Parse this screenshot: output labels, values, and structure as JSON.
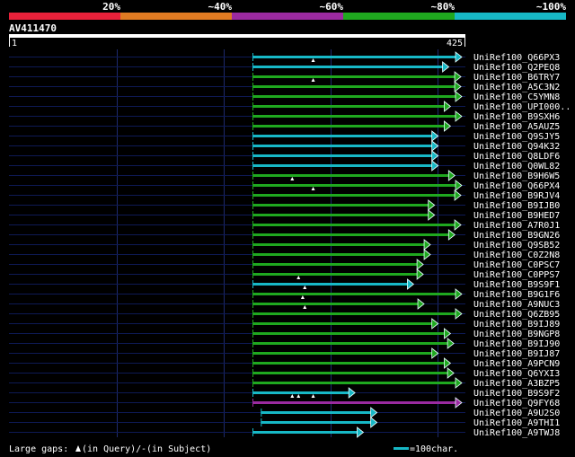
{
  "legend_bar": {
    "segments": [
      {
        "label": "20%",
        "color": "#e8213a"
      },
      {
        "label": "~40%",
        "color": "#e07b22"
      },
      {
        "label": "~60%",
        "color": "#9b2aa0"
      },
      {
        "label": "~80%",
        "color": "#1fa81f"
      },
      {
        "label": "~100%",
        "color": "#17b8c6"
      }
    ]
  },
  "query": {
    "id": "AV411470",
    "start": "1",
    "end": "425"
  },
  "hits": [
    {
      "name": "UniRef100_Q66PX3",
      "color": "cyan",
      "start": 0.0,
      "end": 1.0,
      "marks": []
    },
    {
      "name": "UniRef100_Q2PEQ8",
      "color": "cyan",
      "start": 0.0,
      "end": 0.938,
      "marks": [
        0.29
      ]
    },
    {
      "name": "UniRef100_B6TRY7",
      "color": "green",
      "start": 0.0,
      "end": 0.996,
      "marks": []
    },
    {
      "name": "UniRef100_A5C3N2",
      "color": "green",
      "start": 0.0,
      "end": 0.996,
      "marks": [
        0.29
      ]
    },
    {
      "name": "UniRef100_C5YMN8",
      "color": "green",
      "start": 0.0,
      "end": 1.0,
      "marks": []
    },
    {
      "name": "UniRef100_UPI000..",
      "color": "green",
      "start": 0.0,
      "end": 0.946,
      "marks": []
    },
    {
      "name": "UniRef100_B9SXH6",
      "color": "green",
      "start": 0.0,
      "end": 1.0,
      "marks": []
    },
    {
      "name": "UniRef100_A5AUZ5",
      "color": "green",
      "start": 0.0,
      "end": 0.946,
      "marks": []
    },
    {
      "name": "UniRef100_Q9SJY5",
      "color": "cyan",
      "start": 0.0,
      "end": 0.887,
      "marks": []
    },
    {
      "name": "UniRef100_Q94K32",
      "color": "cyan",
      "start": 0.0,
      "end": 0.887,
      "marks": []
    },
    {
      "name": "UniRef100_Q8LDF6",
      "color": "cyan",
      "start": 0.0,
      "end": 0.887,
      "marks": []
    },
    {
      "name": "UniRef100_Q0WL82",
      "color": "cyan",
      "start": 0.0,
      "end": 0.887,
      "marks": []
    },
    {
      "name": "UniRef100_B9H6W5",
      "color": "green",
      "start": 0.0,
      "end": 0.967,
      "marks": []
    },
    {
      "name": "UniRef100_Q66PX4",
      "color": "green",
      "start": 0.0,
      "end": 1.0,
      "marks": [
        0.19
      ]
    },
    {
      "name": "UniRef100_B9RJV4",
      "color": "green",
      "start": 0.0,
      "end": 0.996,
      "marks": [
        0.29
      ]
    },
    {
      "name": "UniRef100_B9IJB0",
      "color": "green",
      "start": 0.0,
      "end": 0.87,
      "marks": []
    },
    {
      "name": "UniRef100_B9HED7",
      "color": "green",
      "start": 0.0,
      "end": 0.87,
      "marks": []
    },
    {
      "name": "UniRef100_A7R0J1",
      "color": "green",
      "start": 0.0,
      "end": 0.996,
      "marks": []
    },
    {
      "name": "UniRef100_B9GN26",
      "color": "green",
      "start": 0.0,
      "end": 0.967,
      "marks": []
    },
    {
      "name": "UniRef100_Q9SB52",
      "color": "green",
      "start": 0.0,
      "end": 0.85,
      "marks": []
    },
    {
      "name": "UniRef100_C0Z2N8",
      "color": "green",
      "start": 0.0,
      "end": 0.85,
      "marks": []
    },
    {
      "name": "UniRef100_C0PSC7",
      "color": "green",
      "start": 0.0,
      "end": 0.816,
      "marks": []
    },
    {
      "name": "UniRef100_C0PPS7",
      "color": "green",
      "start": 0.0,
      "end": 0.816,
      "marks": []
    },
    {
      "name": "UniRef100_B9S9F1",
      "color": "cyan",
      "start": 0.0,
      "end": 0.77,
      "marks": [
        0.22
      ]
    },
    {
      "name": "UniRef100_B9G1F6",
      "color": "green",
      "start": 0.0,
      "end": 1.0,
      "marks": [
        0.25
      ]
    },
    {
      "name": "UniRef100_A9NUC3",
      "color": "green",
      "start": 0.0,
      "end": 0.82,
      "marks": [
        0.24
      ]
    },
    {
      "name": "UniRef100_Q6ZB95",
      "color": "green",
      "start": 0.0,
      "end": 1.0,
      "marks": [
        0.25
      ]
    },
    {
      "name": "UniRef100_B9IJ89",
      "color": "green",
      "start": 0.0,
      "end": 0.887,
      "marks": []
    },
    {
      "name": "UniRef100_B9NGP8",
      "color": "green",
      "start": 0.0,
      "end": 0.946,
      "marks": []
    },
    {
      "name": "UniRef100_B9IJ90",
      "color": "green",
      "start": 0.0,
      "end": 0.962,
      "marks": []
    },
    {
      "name": "UniRef100_B9IJ87",
      "color": "green",
      "start": 0.0,
      "end": 0.887,
      "marks": []
    },
    {
      "name": "UniRef100_A9PCN9",
      "color": "green",
      "start": 0.0,
      "end": 0.946,
      "marks": []
    },
    {
      "name": "UniRef100_Q6YXI3",
      "color": "green",
      "start": 0.0,
      "end": 0.962,
      "marks": []
    },
    {
      "name": "UniRef100_A3BZP5",
      "color": "green",
      "start": 0.0,
      "end": 1.0,
      "marks": []
    },
    {
      "name": "UniRef100_B9S9F2",
      "color": "cyan",
      "start": 0.0,
      "end": 0.49,
      "marks": []
    },
    {
      "name": "UniRef100_Q9FY68",
      "color": "purple",
      "start": 0.0,
      "end": 1.0,
      "marks": [
        0.19,
        0.22,
        0.29
      ]
    },
    {
      "name": "UniRef100_A9U2S0",
      "color": "cyan",
      "start": 0.04,
      "end": 0.595,
      "marks": []
    },
    {
      "name": "UniRef100_A9THI1",
      "color": "cyan",
      "start": 0.04,
      "end": 0.595,
      "marks": []
    },
    {
      "name": "UniRef100_A9TWJ8",
      "color": "cyan",
      "start": 0.0,
      "end": 0.53,
      "marks": []
    }
  ],
  "footer": {
    "gaps_text": "Large gaps:",
    "gaps_query": "(in Query)/",
    "gaps_dash": "-",
    "gaps_subject": " (in Subject)",
    "scale_text": "=100char."
  },
  "colors": {
    "cyan": "#17b8c6",
    "green": "#1fa81f",
    "purple": "#9b2aa0",
    "track": "#0e1a55",
    "grid": "#1d2a6e"
  }
}
